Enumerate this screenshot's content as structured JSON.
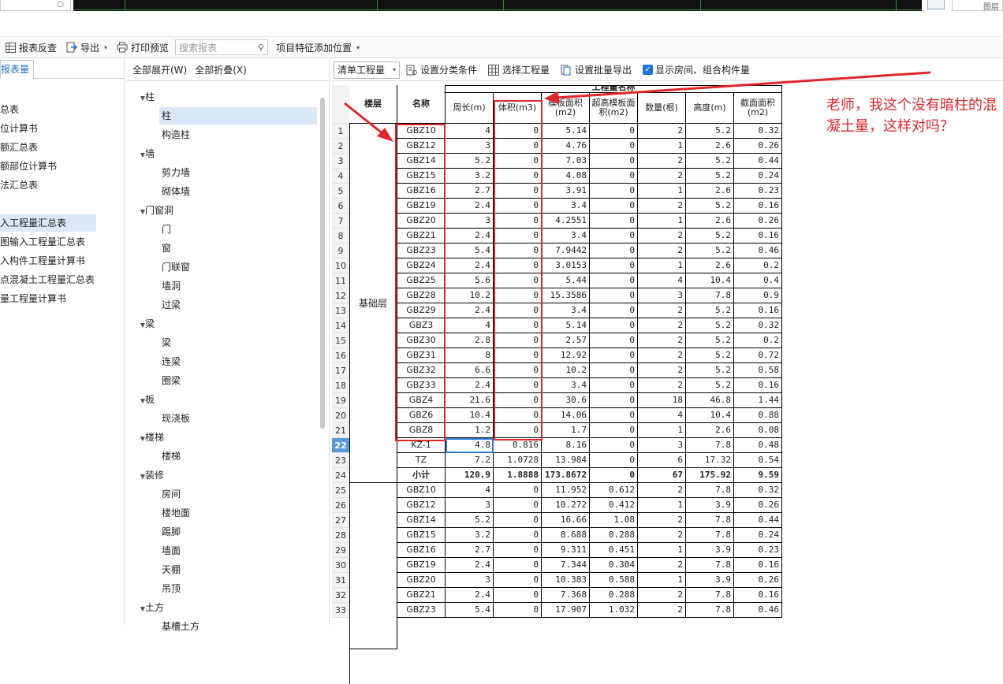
{
  "top": {
    "right_text": "图层"
  },
  "toolbar": {
    "report_check": "报表反查",
    "export": "导出",
    "print_preview": "打印预览",
    "search_placeholder": "搜索报表",
    "add_project_feature": "项目特征添加位置"
  },
  "left": {
    "tab": "报表量",
    "items": [
      "总表",
      "位计算书",
      "额汇总表",
      "额部位计算书",
      "法汇总表",
      "入工程量汇总表",
      "图输入工程量汇总表",
      "入构件工程量计算书",
      "点混凝土工程量汇总表",
      "量工程量计算书"
    ]
  },
  "mid": {
    "expand_all": "全部展开(W)",
    "collapse_all": "全部折叠(X)",
    "tree": [
      {
        "cat": "柱",
        "leaves": [
          "柱",
          "构造柱"
        ]
      },
      {
        "cat": "墙",
        "leaves": [
          "剪力墙",
          "砌体墙"
        ]
      },
      {
        "cat": "门窗洞",
        "leaves": [
          "门",
          "窗",
          "门联窗",
          "墙洞",
          "过梁"
        ]
      },
      {
        "cat": "梁",
        "leaves": [
          "梁",
          "连梁",
          "圈梁"
        ]
      },
      {
        "cat": "板",
        "leaves": [
          "现浇板"
        ]
      },
      {
        "cat": "楼梯",
        "leaves": [
          "楼梯"
        ]
      },
      {
        "cat": "装修",
        "leaves": [
          "房间",
          "楼地面",
          "踢脚",
          "墙面",
          "天棚",
          "吊顶"
        ]
      },
      {
        "cat": "土方",
        "leaves": [
          "基槽土方"
        ]
      }
    ]
  },
  "right_toolbar": {
    "combo": "清单工程量",
    "set_category": "设置分类条件",
    "select_quantity": "选择工程量",
    "set_batch_export": "设置批量导出",
    "show_rooms": "显示房间、组合构件量"
  },
  "table": {
    "group_header": "工程量名称",
    "headers": [
      "楼层",
      "名称",
      "周长(m)",
      "体积(m3)",
      "模板面积(m2)",
      "超高模板面积(m2)",
      "数量(根)",
      "高度(m)",
      "截面面积(m2)"
    ],
    "floor": "基础层",
    "rows": [
      [
        "GBZ10",
        "4",
        "0",
        "5.14",
        "0",
        "2",
        "5.2",
        "0.32"
      ],
      [
        "GBZ12",
        "3",
        "0",
        "4.76",
        "0",
        "1",
        "2.6",
        "0.26"
      ],
      [
        "GBZ14",
        "5.2",
        "0",
        "7.03",
        "0",
        "2",
        "5.2",
        "0.44"
      ],
      [
        "GBZ15",
        "3.2",
        "0",
        "4.08",
        "0",
        "2",
        "5.2",
        "0.24"
      ],
      [
        "GBZ16",
        "2.7",
        "0",
        "3.91",
        "0",
        "1",
        "2.6",
        "0.23"
      ],
      [
        "GBZ19",
        "2.4",
        "0",
        "3.4",
        "0",
        "2",
        "5.2",
        "0.16"
      ],
      [
        "GBZ20",
        "3",
        "0",
        "4.2551",
        "0",
        "1",
        "2.6",
        "0.26"
      ],
      [
        "GBZ21",
        "2.4",
        "0",
        "3.4",
        "0",
        "2",
        "5.2",
        "0.16"
      ],
      [
        "GBZ23",
        "5.4",
        "0",
        "7.9442",
        "0",
        "2",
        "5.2",
        "0.46"
      ],
      [
        "GBZ24",
        "2.4",
        "0",
        "3.0153",
        "0",
        "1",
        "2.6",
        "0.2"
      ],
      [
        "GBZ25",
        "5.6",
        "0",
        "5.44",
        "0",
        "4",
        "10.4",
        "0.4"
      ],
      [
        "GBZ28",
        "10.2",
        "0",
        "15.3586",
        "0",
        "3",
        "7.8",
        "0.9"
      ],
      [
        "GBZ29",
        "2.4",
        "0",
        "3.4",
        "0",
        "2",
        "5.2",
        "0.16"
      ],
      [
        "GBZ3",
        "4",
        "0",
        "5.14",
        "0",
        "2",
        "5.2",
        "0.32"
      ],
      [
        "GBZ30",
        "2.8",
        "0",
        "2.57",
        "0",
        "2",
        "5.2",
        "0.2"
      ],
      [
        "GBZ31",
        "8",
        "0",
        "12.92",
        "0",
        "2",
        "5.2",
        "0.72"
      ],
      [
        "GBZ32",
        "6.6",
        "0",
        "10.2",
        "0",
        "2",
        "5.2",
        "0.58"
      ],
      [
        "GBZ33",
        "2.4",
        "0",
        "3.4",
        "0",
        "2",
        "5.2",
        "0.16"
      ],
      [
        "GBZ4",
        "21.6",
        "0",
        "30.6",
        "0",
        "18",
        "46.8",
        "1.44"
      ],
      [
        "GBZ6",
        "10.4",
        "0",
        "14.06",
        "0",
        "4",
        "10.4",
        "0.88"
      ],
      [
        "GBZ8",
        "1.2",
        "0",
        "1.7",
        "0",
        "1",
        "2.6",
        "0.08"
      ],
      [
        "KZ-1",
        "4.8",
        "0.816",
        "8.16",
        "0",
        "3",
        "7.8",
        "0.48"
      ],
      [
        "TZ",
        "7.2",
        "1.0728",
        "13.984",
        "0",
        "6",
        "17.32",
        "0.54"
      ],
      [
        "小计",
        "120.9",
        "1.8888",
        "173.8672",
        "0",
        "67",
        "175.92",
        "9.59"
      ],
      [
        "GBZ10",
        "4",
        "0",
        "11.952",
        "0.612",
        "2",
        "7.8",
        "0.32"
      ],
      [
        "GBZ12",
        "3",
        "0",
        "10.272",
        "0.412",
        "1",
        "3.9",
        "0.26"
      ],
      [
        "GBZ14",
        "5.2",
        "0",
        "16.66",
        "1.08",
        "2",
        "7.8",
        "0.44"
      ],
      [
        "GBZ15",
        "3.2",
        "0",
        "8.688",
        "0.288",
        "2",
        "7.8",
        "0.24"
      ],
      [
        "GBZ16",
        "2.7",
        "0",
        "9.311",
        "0.451",
        "1",
        "3.9",
        "0.23"
      ],
      [
        "GBZ19",
        "2.4",
        "0",
        "7.344",
        "0.304",
        "2",
        "7.8",
        "0.16"
      ],
      [
        "GBZ20",
        "3",
        "0",
        "10.383",
        "0.588",
        "1",
        "3.9",
        "0.26"
      ],
      [
        "GBZ21",
        "2.4",
        "0",
        "7.368",
        "0.288",
        "2",
        "7.8",
        "0.16"
      ],
      [
        "GBZ23",
        "5.4",
        "0",
        "17.907",
        "1.032",
        "2",
        "7.8",
        "0.46"
      ]
    ],
    "current_row": 22
  },
  "annotation": {
    "note": "老师，我这个没有暗柱的混凝土量，这样对吗？",
    "color": "#e0262b"
  }
}
